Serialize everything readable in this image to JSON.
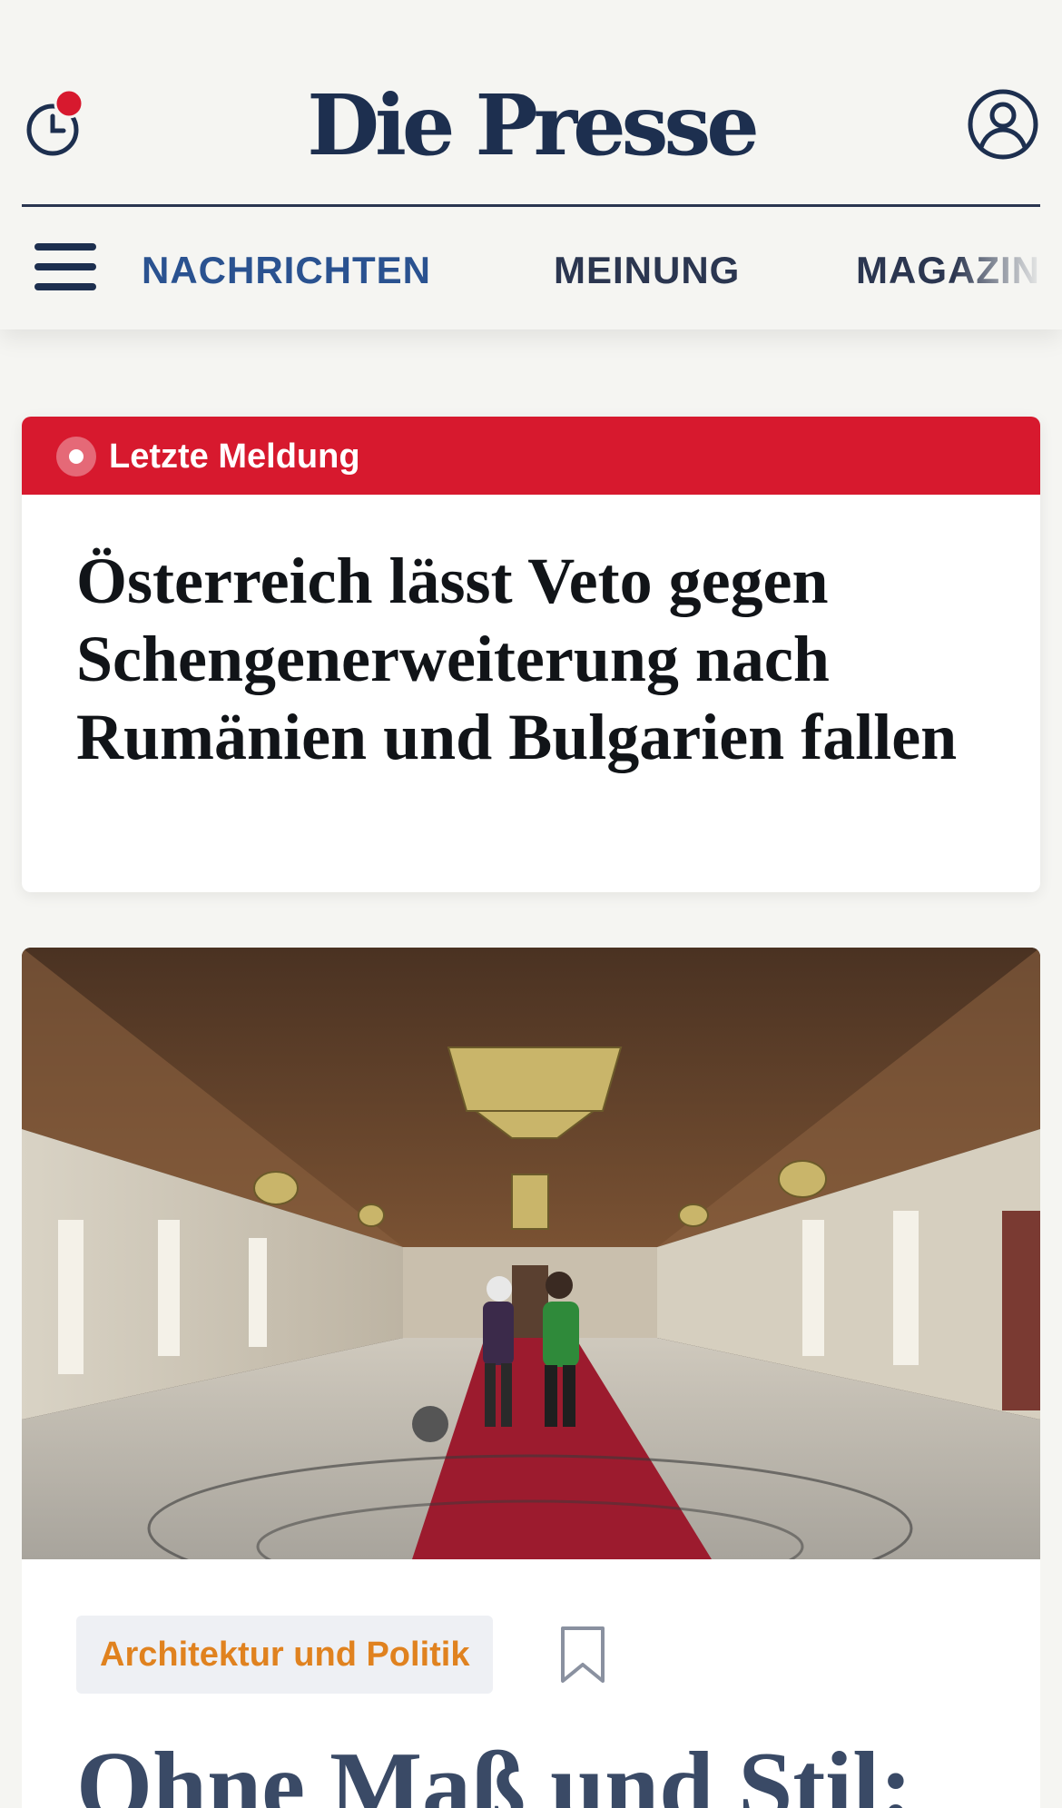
{
  "header": {
    "logo": "Die Presse",
    "history_icon": "clock-notification-icon",
    "account_icon": "user-account-icon",
    "notification_color": "#d7192e"
  },
  "nav": {
    "menu_icon": "hamburger-menu-icon",
    "items": [
      {
        "label": "NACHRICHTEN",
        "active": true
      },
      {
        "label": "MEINUNG",
        "active": false
      },
      {
        "label": "MAGAZIN",
        "active": false
      }
    ]
  },
  "breaking": {
    "label": "Letzte Meldung",
    "headline": "Österreich lässt Veto gegen Schengenerweiterung nach Rumänien und Bulgarien fallen",
    "bar_color": "#d7192e"
  },
  "article": {
    "category": "Architektur und Politik",
    "headline": "Ohne Maß und Stil:",
    "bookmark_icon": "bookmark-icon",
    "category_color": "#e0821f"
  },
  "colors": {
    "brand_navy": "#1d2f4f",
    "nav_active": "#2a5290",
    "background": "#f5f5f2"
  }
}
